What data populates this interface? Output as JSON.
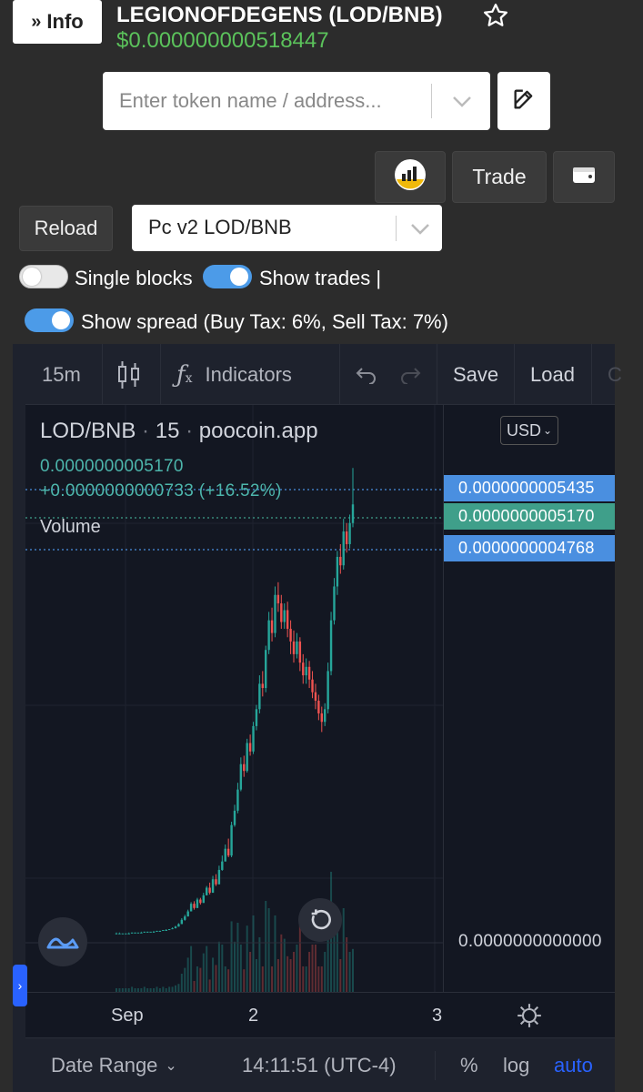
{
  "header": {
    "info_label": "Info",
    "token_title": "LEGIONOFDEGENS (LOD/BNB)",
    "price": "$0.000000000518447"
  },
  "search": {
    "placeholder": "Enter token name / address..."
  },
  "toolbar": {
    "trade_label": "Trade",
    "reload_label": "Reload",
    "pair_value": "Pc v2 LOD/BNB"
  },
  "toggles": {
    "single_blocks": {
      "label": "Single blocks",
      "on": false
    },
    "show_trades": {
      "label": "Show trades |",
      "on": true
    },
    "show_spread": {
      "label": "Show spread (Buy Tax: 6%, Sell Tax: 7%)",
      "on": true
    }
  },
  "chart_toolbar": {
    "interval": "15m",
    "indicators": "Indicators",
    "save": "Save",
    "load": "Load",
    "cut": "C"
  },
  "chart": {
    "legend_symbol": "LOD/BNB",
    "legend_interval": "15",
    "legend_source": "poocoin.app",
    "legend_value": "0.0000000005170",
    "legend_change": "+0.0000000000733 (+16.52%)",
    "volume_label": "Volume",
    "currency": "USD",
    "price_tags": [
      {
        "value": "0.0000000005435",
        "color": "#4a8fe0"
      },
      {
        "value": "0.0000000005170",
        "color": "#3f9f8a"
      },
      {
        "value": "0.0000000004768",
        "color": "#4a8fe0"
      }
    ],
    "zero_label": "0.0000000000000",
    "time_ticks": [
      "Sep",
      "2",
      "3"
    ]
  },
  "bottom_bar": {
    "date_range": "Date Range",
    "time": "14:11:51 (UTC-4)",
    "pct": "%",
    "log": "log",
    "auto": "auto"
  },
  "colors": {
    "up": "#26a69a",
    "down": "#ef5350",
    "accent": "#2962ff",
    "price_green": "#5bc25b"
  },
  "chart_data": {
    "type": "candlestick",
    "x_ticks": [
      "Sep",
      "2",
      "3"
    ],
    "last_close": 5.17e-10,
    "change": 7.33e-11,
    "change_pct": 16.52,
    "candles": [
      [
        0.1,
        0.1,
        0.11,
        0.1
      ],
      [
        0.1,
        0.1,
        0.11,
        0.1
      ],
      [
        0.1,
        0.1,
        0.1,
        0.1
      ],
      [
        0.1,
        0.1,
        0.1,
        0.1
      ],
      [
        0.1,
        0.1,
        0.11,
        0.1
      ],
      [
        0.1,
        0.11,
        0.11,
        0.1
      ],
      [
        0.11,
        0.11,
        0.11,
        0.1
      ],
      [
        0.11,
        0.11,
        0.11,
        0.11
      ],
      [
        0.11,
        0.11,
        0.12,
        0.11
      ],
      [
        0.11,
        0.12,
        0.12,
        0.11
      ],
      [
        0.12,
        0.12,
        0.12,
        0.11
      ],
      [
        0.12,
        0.12,
        0.12,
        0.12
      ],
      [
        0.12,
        0.12,
        0.13,
        0.12
      ],
      [
        0.12,
        0.13,
        0.13,
        0.12
      ],
      [
        0.13,
        0.13,
        0.13,
        0.12
      ],
      [
        0.13,
        0.14,
        0.14,
        0.13
      ],
      [
        0.14,
        0.14,
        0.15,
        0.13
      ],
      [
        0.14,
        0.15,
        0.15,
        0.14
      ],
      [
        0.15,
        0.16,
        0.17,
        0.15
      ],
      [
        0.16,
        0.18,
        0.19,
        0.16
      ],
      [
        0.18,
        0.21,
        0.22,
        0.18
      ],
      [
        0.21,
        0.26,
        0.28,
        0.21
      ],
      [
        0.26,
        0.3,
        0.32,
        0.25
      ],
      [
        0.3,
        0.36,
        0.38,
        0.3
      ],
      [
        0.36,
        0.45,
        0.47,
        0.36
      ],
      [
        0.45,
        0.4,
        0.48,
        0.38
      ],
      [
        0.4,
        0.5,
        0.52,
        0.4
      ],
      [
        0.5,
        0.46,
        0.52,
        0.44
      ],
      [
        0.46,
        0.55,
        0.58,
        0.46
      ],
      [
        0.55,
        0.64,
        0.66,
        0.55
      ],
      [
        0.64,
        0.58,
        0.7,
        0.56
      ],
      [
        0.58,
        0.74,
        0.78,
        0.58
      ],
      [
        0.74,
        0.68,
        0.8,
        0.66
      ],
      [
        0.68,
        0.85,
        0.9,
        0.68
      ],
      [
        0.85,
        0.95,
        1.02,
        0.84
      ],
      [
        0.95,
        1.1,
        1.15,
        0.95
      ],
      [
        1.1,
        1.02,
        1.22,
        1.0
      ],
      [
        1.02,
        1.38,
        1.42,
        1.0
      ],
      [
        1.38,
        1.55,
        1.62,
        1.36
      ],
      [
        1.55,
        1.8,
        1.88,
        1.52
      ],
      [
        1.8,
        2.1,
        2.18,
        1.78
      ],
      [
        2.1,
        2.02,
        2.2,
        1.95
      ],
      [
        2.02,
        2.35,
        2.4,
        2.0
      ],
      [
        2.35,
        2.25,
        2.45,
        2.2
      ],
      [
        2.25,
        2.55,
        2.6,
        2.22
      ],
      [
        2.55,
        2.75,
        2.8,
        2.5
      ],
      [
        2.75,
        3.05,
        3.15,
        2.7
      ],
      [
        3.05,
        3.0,
        3.2,
        2.9
      ],
      [
        3.0,
        3.45,
        3.5,
        2.95
      ],
      [
        3.45,
        3.8,
        3.9,
        3.4
      ],
      [
        3.8,
        3.65,
        3.95,
        3.55
      ],
      [
        3.65,
        4.1,
        4.2,
        3.6
      ],
      [
        4.1,
        4.0,
        4.25,
        3.9
      ],
      [
        4.0,
        3.78,
        4.1,
        3.7
      ],
      [
        3.78,
        3.92,
        4.0,
        3.7
      ],
      [
        3.92,
        3.7,
        4.02,
        3.6
      ],
      [
        3.7,
        3.55,
        3.8,
        3.4
      ],
      [
        3.55,
        3.4,
        3.68,
        3.3
      ],
      [
        3.4,
        3.55,
        3.65,
        3.35
      ],
      [
        3.55,
        3.3,
        3.6,
        3.2
      ],
      [
        3.3,
        3.15,
        3.4,
        3.05
      ],
      [
        3.15,
        3.25,
        3.35,
        3.05
      ],
      [
        3.25,
        3.1,
        3.32,
        3.0
      ],
      [
        3.1,
        2.95,
        3.2,
        2.88
      ],
      [
        2.95,
        2.85,
        3.05,
        2.75
      ],
      [
        2.85,
        2.7,
        2.92,
        2.62
      ],
      [
        2.7,
        2.6,
        2.78,
        2.48
      ],
      [
        2.6,
        2.75,
        2.82,
        2.55
      ],
      [
        2.75,
        3.2,
        3.3,
        2.7
      ],
      [
        3.2,
        3.8,
        3.9,
        3.15
      ],
      [
        3.8,
        4.2,
        4.3,
        3.75
      ],
      [
        4.2,
        4.55,
        4.62,
        4.1
      ],
      [
        4.55,
        4.45,
        4.7,
        4.35
      ],
      [
        4.45,
        4.85,
        5.0,
        4.4
      ],
      [
        4.85,
        4.7,
        4.95,
        4.6
      ],
      [
        4.7,
        4.95,
        5.05,
        4.65
      ],
      [
        4.95,
        5.17,
        5.6,
        4.9
      ]
    ]
  }
}
